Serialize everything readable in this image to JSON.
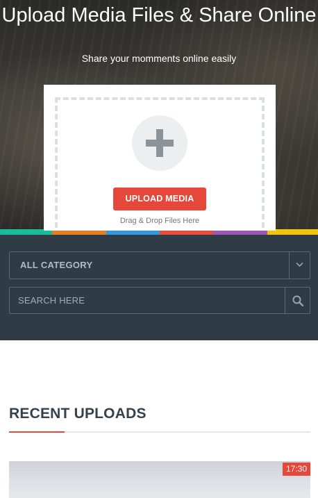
{
  "hero": {
    "title": "Upload Media Files & Share Online",
    "subtitle": "Share your momments online easily"
  },
  "upload": {
    "icon": "plus-icon",
    "button_label": "UPLOAD MEDIA",
    "hint": "Drag & Drop Files Here"
  },
  "color_strip": [
    "#1abc9c",
    "#e67e22",
    "#3498db",
    "#e74c3c",
    "#9b59b6",
    "#f1c40f"
  ],
  "filters": {
    "category_selected": "ALL CATEGORY",
    "search_placeholder": "SEARCH HERE",
    "dropdown_icon": "chevron-down-icon",
    "search_icon": "search-icon"
  },
  "recent": {
    "title": "RECENT UPLOADS",
    "items": [
      {
        "duration": "17:30"
      }
    ]
  },
  "colors": {
    "accent": "#e5483b",
    "panel": "#2f3b45",
    "heading": "#36424b"
  }
}
